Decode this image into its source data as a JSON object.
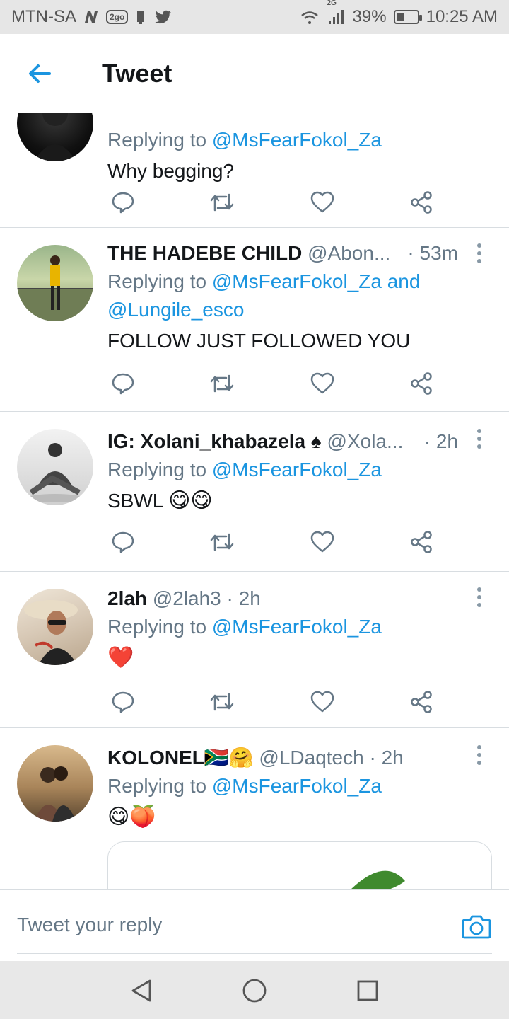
{
  "status_bar": {
    "carrier": "MTN-SA",
    "left_icons": [
      "n-logo-icon",
      "2go-icon",
      "notification-icon",
      "twitter-bird-icon"
    ],
    "badge_2go": "2go",
    "network": "2G",
    "battery": "39%",
    "battery_level": 0.39,
    "time": "10:25 AM"
  },
  "header": {
    "title": "Tweet",
    "back_icon": "arrow-left-icon"
  },
  "tweets": [
    {
      "name": "",
      "handle": "",
      "time": "",
      "replying_prefix": "Replying to",
      "replying_to": "@MsFearFokol_Za",
      "text": "Why begging?"
    },
    {
      "name": "THE HADEBE CHILD",
      "handle": "@Abon...",
      "time": "· 53m",
      "replying_prefix": "Replying to",
      "replying_to": "@MsFearFokol_Za",
      "replying_and": "and",
      "replying_to_2": "@Lungile_esco",
      "text": "FOLLOW JUST FOLLOWED YOU"
    },
    {
      "name": "IG: Xolani_khabazela",
      "name_emoji": "♠",
      "handle": "@Xola...",
      "time": "· 2h",
      "replying_prefix": "Replying to",
      "replying_to": "@MsFearFokol_Za",
      "text": "SBWL",
      "text_emoji": "😋😋"
    },
    {
      "name": "2lah",
      "handle": "@2lah3",
      "time": "· 2h",
      "replying_prefix": "Replying to",
      "replying_to": "@MsFearFokol_Za",
      "text_emoji": "❤️"
    },
    {
      "name": "KOLONEL",
      "name_emoji": "🇿🇦🤗",
      "handle": "@LDaqtech",
      "time": "· 2h",
      "replying_prefix": "Replying to",
      "replying_to": "@MsFearFokol_Za",
      "text_emoji": "😋🍑"
    }
  ],
  "actions": [
    "reply-icon",
    "retweet-icon",
    "like-icon",
    "share-icon"
  ],
  "reply_bar": {
    "placeholder": "Tweet your reply",
    "camera_icon": "camera-icon"
  },
  "nav_bar": [
    "back-triangle-icon",
    "home-circle-icon",
    "recents-square-icon"
  ],
  "colors": {
    "accent": "#1b95e0",
    "secondary_text": "#657786",
    "divider": "#d8dde1",
    "status_bar": "#e6e6e6"
  }
}
